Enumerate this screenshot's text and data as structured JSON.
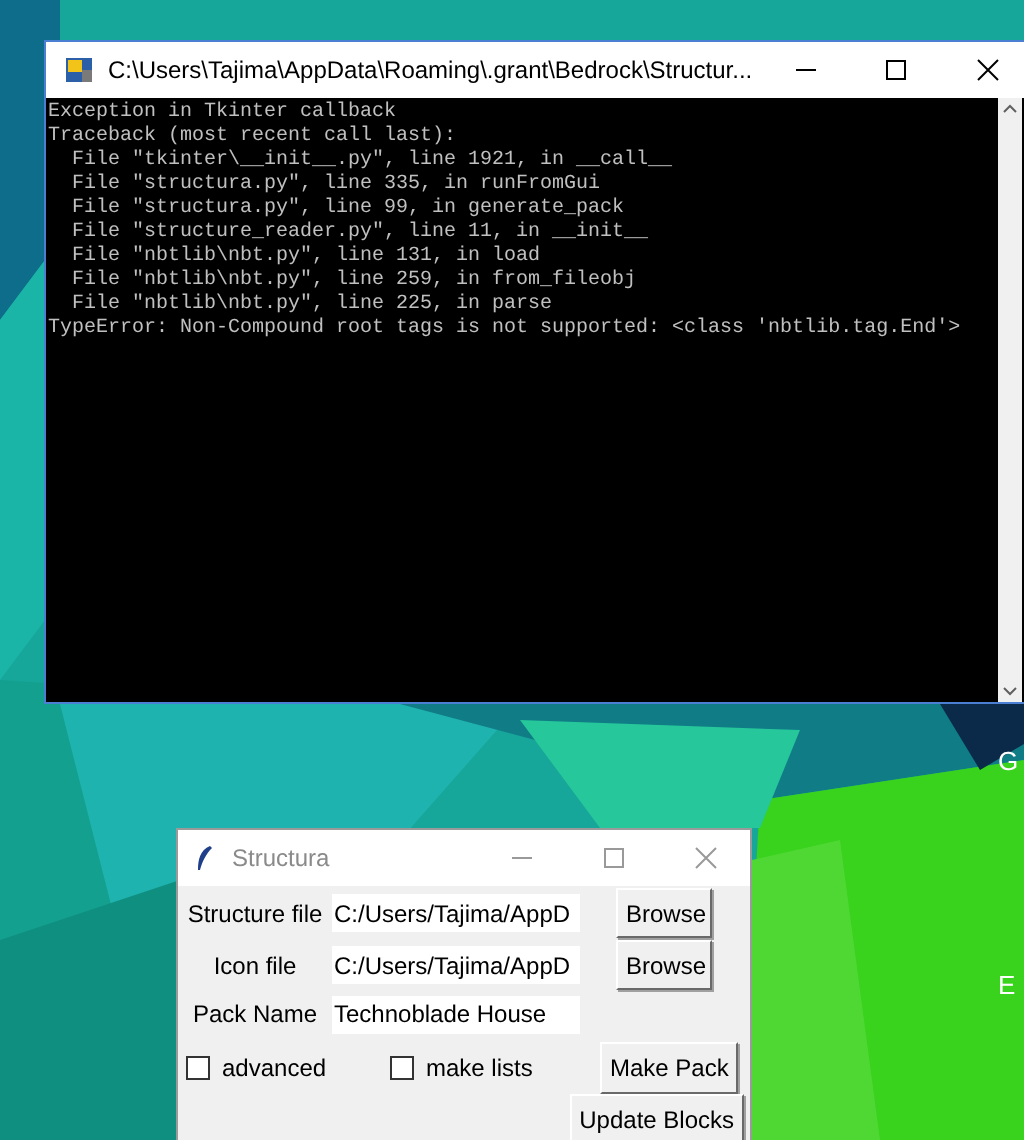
{
  "desktop": {
    "labels": [
      "G",
      "E"
    ]
  },
  "console_window": {
    "title": "C:\\Users\\Tajima\\AppData\\Roaming\\.grant\\Bedrock\\Structur...",
    "lines": [
      "Exception in Tkinter callback",
      "Traceback (most recent call last):",
      "  File \"tkinter\\__init__.py\", line 1921, in __call__",
      "  File \"structura.py\", line 335, in runFromGui",
      "  File \"structura.py\", line 99, in generate_pack",
      "  File \"structure_reader.py\", line 11, in __init__",
      "  File \"nbtlib\\nbt.py\", line 131, in load",
      "  File \"nbtlib\\nbt.py\", line 259, in from_fileobj",
      "  File \"nbtlib\\nbt.py\", line 225, in parse",
      "TypeError: Non-Compound root tags is not supported: <class 'nbtlib.tag.End'>"
    ]
  },
  "structura_window": {
    "title": "Structura",
    "fields": [
      {
        "label": "Structure file",
        "value": "C:/Users/Tajima/AppD",
        "button": "Browse"
      },
      {
        "label": "Icon file",
        "value": "C:/Users/Tajima/AppD",
        "button": "Browse"
      },
      {
        "label": "Pack Name",
        "value": "Technoblade House"
      }
    ],
    "checkboxes": [
      {
        "label": "advanced",
        "checked": false
      },
      {
        "label": "make lists",
        "checked": false
      }
    ],
    "buttons": [
      "Make Pack",
      "Update Blocks"
    ]
  }
}
